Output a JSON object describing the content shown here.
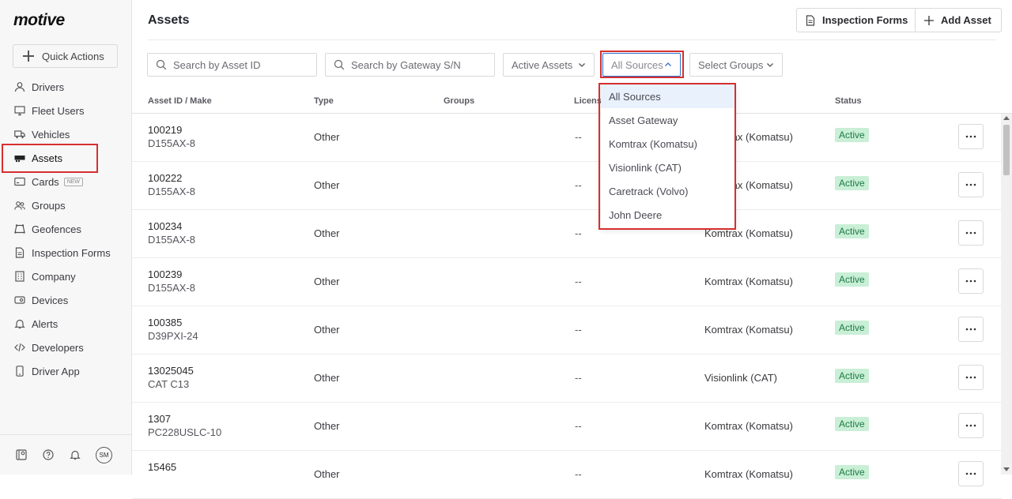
{
  "brand": {
    "logo": "motive"
  },
  "sidebar": {
    "quick_actions": "Quick Actions",
    "items": [
      {
        "label": "Drivers",
        "icon": "user-icon"
      },
      {
        "label": "Fleet Users",
        "icon": "monitor-icon"
      },
      {
        "label": "Vehicles",
        "icon": "truck-icon"
      },
      {
        "label": "Assets",
        "icon": "trailer-icon"
      },
      {
        "label": "Cards",
        "icon": "card-icon",
        "badge": "NEW"
      },
      {
        "label": "Groups",
        "icon": "users-icon"
      },
      {
        "label": "Geofences",
        "icon": "geofence-icon"
      },
      {
        "label": "Inspection Forms",
        "icon": "document-icon"
      },
      {
        "label": "Company",
        "icon": "building-icon"
      },
      {
        "label": "Devices",
        "icon": "device-icon"
      },
      {
        "label": "Alerts",
        "icon": "bell-icon"
      },
      {
        "label": "Developers",
        "icon": "code-icon"
      },
      {
        "label": "Driver App",
        "icon": "phone-icon"
      }
    ],
    "footer": {
      "avatar_initials": "SM"
    }
  },
  "header": {
    "title": "Assets",
    "inspection_forms_label": "Inspection Forms",
    "add_asset_label": "Add Asset"
  },
  "filters": {
    "asset_id_placeholder": "Search by Asset ID",
    "gateway_placeholder": "Search by Gateway S/N",
    "active_assets": "Active Assets",
    "sources": "All Sources",
    "groups": "Select Groups"
  },
  "sources_menu": {
    "options": [
      "All Sources",
      "Asset Gateway",
      "Komtrax (Komatsu)",
      "Visionlink (CAT)",
      "Caretrack (Volvo)",
      "John Deere"
    ]
  },
  "table": {
    "columns": {
      "asset": "Asset ID / Make",
      "type": "Type",
      "groups": "Groups",
      "license": "Licens",
      "status": "Status"
    },
    "rows": [
      {
        "id": "100219",
        "make": "D155AX-8",
        "type": "Other",
        "license": "--",
        "source": "Komtrax (Komatsu)",
        "status": "Active"
      },
      {
        "id": "100222",
        "make": "D155AX-8",
        "type": "Other",
        "license": "--",
        "source": "Komtrax (Komatsu)",
        "status": "Active"
      },
      {
        "id": "100234",
        "make": "D155AX-8",
        "type": "Other",
        "license": "--",
        "source": "Komtrax (Komatsu)",
        "status": "Active"
      },
      {
        "id": "100239",
        "make": "D155AX-8",
        "type": "Other",
        "license": "--",
        "source": "Komtrax (Komatsu)",
        "status": "Active"
      },
      {
        "id": "100385",
        "make": "D39PXI-24",
        "type": "Other",
        "license": "--",
        "source": "Komtrax (Komatsu)",
        "status": "Active"
      },
      {
        "id": "13025045",
        "make": "CAT C13",
        "type": "Other",
        "license": "--",
        "source": "Visionlink (CAT)",
        "status": "Active"
      },
      {
        "id": "1307",
        "make": "PC228USLC-10",
        "type": "Other",
        "license": "--",
        "source": "Komtrax (Komatsu)",
        "status": "Active"
      },
      {
        "id": "15465",
        "make": "",
        "type": "Other",
        "license": "--",
        "source": "Komtrax (Komatsu)",
        "status": "Active"
      }
    ]
  },
  "colors": {
    "highlight": "#d62f2f",
    "status_bg": "#c9efd6",
    "status_text": "#1d7a45",
    "menu_selected": "#e9f1fd"
  }
}
